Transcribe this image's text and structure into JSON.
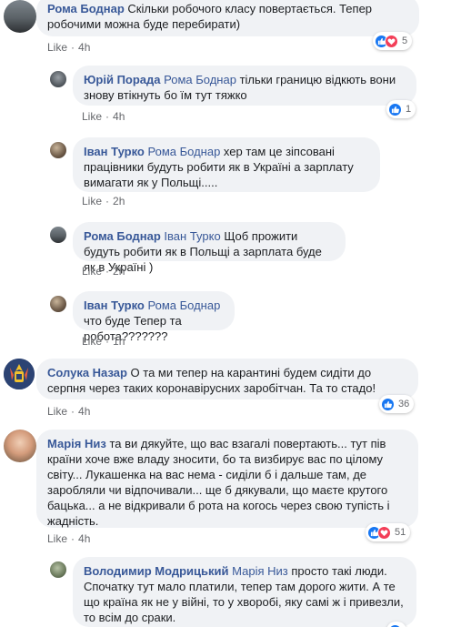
{
  "comments": [
    {
      "author": "Рома Боднар",
      "reply_to": "",
      "text": "Скільки робочого класу повертається. Тепер робочими можна буде перебирати)",
      "like_label": "Like",
      "time": "4h",
      "reaction_count": "5"
    },
    {
      "author": "Юрій Порада",
      "reply_to": "Рома Боднар",
      "text": "тільки границю відкють вони знову втікнуть бо їм тут тяжко",
      "like_label": "Like",
      "time": "4h",
      "reaction_count": "1"
    },
    {
      "author": "Іван Турко",
      "reply_to": "Рома Боднар",
      "text": "хер там це зіпсовані працівники будуть робити як в Україні а зарплату вимагати як у Польщі.....",
      "like_label": "Like",
      "time": "2h"
    },
    {
      "author": "Рома Боднар",
      "reply_to": "Іван Турко",
      "text": "Щоб прожити будуть робити як в Польщі а зарплата буде як в Україні )",
      "like_label": "Like",
      "time": "2h"
    },
    {
      "author": "Іван Турко",
      "reply_to": "Рома Боднар",
      "text": "что буде Тепер та робота???????",
      "like_label": "Like",
      "time": "1h"
    },
    {
      "author": "Солука Назар",
      "reply_to": "",
      "text": "О та ми тепер на карантині будем сидіти до серпня через таких коронавірусних заробітчан. Та то стадо!",
      "like_label": "Like",
      "time": "4h",
      "reaction_count": "36"
    },
    {
      "author": "Марія Низ",
      "reply_to": "",
      "text": "та ви дякуйте, що вас взагалі повертають... тут пів країни хоче вже владу зносити, бо та визбирує вас по цілому світу... Лукашенка на вас нема - сиділи б і дальше там, де заробляли чи відпочивали... ще б дякували, що маєте крутого бацька... а не відкривали б рота на когось через свою тупість і жадність.",
      "like_label": "Like",
      "time": "4h",
      "reaction_count": "51"
    },
    {
      "author": "Володимир Модрицький",
      "reply_to": "Марія Низ",
      "text": "просто такі люди. Спочатку тут мало платили, тепер там дорого жити. А те що країна як не у війні, то у хворобі, яку самі ж і привезли, то всім до сраки."
    }
  ],
  "separator": "·",
  "colors": {
    "link": "#385898",
    "bubble": "#f0f2f5",
    "like_blue": "#1877f2",
    "love_red": "#f33e58"
  }
}
